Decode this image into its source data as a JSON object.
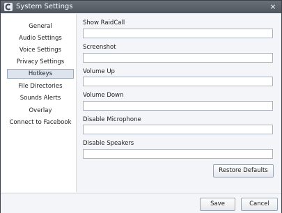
{
  "window": {
    "title": "System Settings",
    "close_glyph": "×"
  },
  "sidebar": {
    "items": [
      {
        "label": "General"
      },
      {
        "label": "Audio Settings"
      },
      {
        "label": "Voice Settings"
      },
      {
        "label": "Privacy Settings"
      },
      {
        "label": "Hotkeys"
      },
      {
        "label": "File Directories"
      },
      {
        "label": "Sounds Alerts"
      },
      {
        "label": "Overlay"
      },
      {
        "label": "Connect to Facebook"
      }
    ],
    "active": "Hotkeys"
  },
  "hotkeys": {
    "fields": [
      {
        "label": "Show RaidCall",
        "value": ""
      },
      {
        "label": "Screenshot",
        "value": ""
      },
      {
        "label": "Volume Up",
        "value": ""
      },
      {
        "label": "Volume Down",
        "value": ""
      },
      {
        "label": "Disable Microphone",
        "value": ""
      },
      {
        "label": "Disable Speakers",
        "value": ""
      }
    ],
    "restore_defaults_label": "Restore Defaults"
  },
  "footer": {
    "save_label": "Save",
    "cancel_label": "Cancel"
  },
  "colors": {
    "titlebar": "#5d636b",
    "active_item_bg": "#dde4ee",
    "panel_bg": "#f3f5f8"
  },
  "icons": {
    "app": "raidcall-logo-icon",
    "close": "close-icon"
  }
}
